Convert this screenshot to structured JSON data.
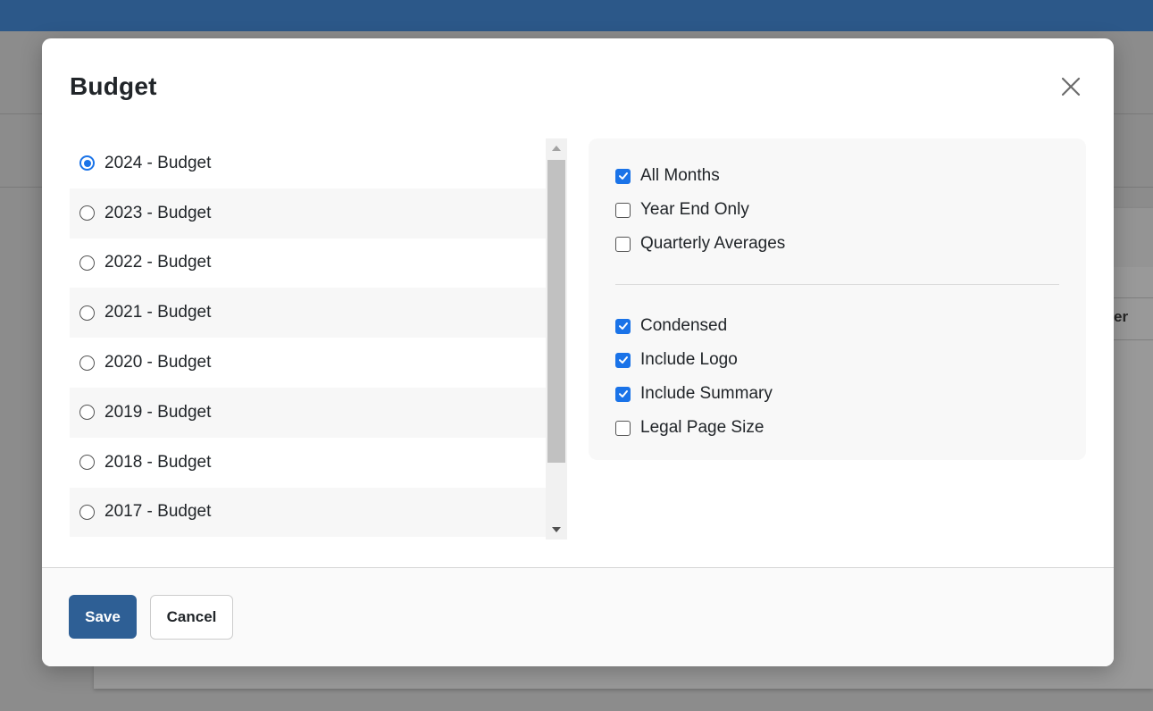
{
  "modal": {
    "title": "Budget"
  },
  "budgets": [
    {
      "label": "2024 - Budget",
      "selected": true
    },
    {
      "label": "2023 - Budget",
      "selected": false
    },
    {
      "label": "2022 - Budget",
      "selected": false
    },
    {
      "label": "2021 - Budget",
      "selected": false
    },
    {
      "label": "2020 - Budget",
      "selected": false
    },
    {
      "label": "2019 - Budget",
      "selected": false
    },
    {
      "label": "2018 - Budget",
      "selected": false
    },
    {
      "label": "2017 - Budget",
      "selected": false
    }
  ],
  "options": {
    "period": [
      {
        "label": "All Months",
        "checked": true
      },
      {
        "label": "Year End Only",
        "checked": false
      },
      {
        "label": "Quarterly Averages",
        "checked": false
      }
    ],
    "format": [
      {
        "label": "Condensed",
        "checked": true
      },
      {
        "label": "Include Logo",
        "checked": true
      },
      {
        "label": "Include Summary",
        "checked": true
      },
      {
        "label": "Legal Page Size",
        "checked": false
      }
    ]
  },
  "footer": {
    "save_label": "Save",
    "cancel_label": "Cancel"
  },
  "background": {
    "column_header_partial": "er"
  },
  "colors": {
    "topbar": "#2c5889",
    "accent": "#1a73e8",
    "primary_button": "#2e5f95"
  },
  "icons": {
    "close": "close-icon",
    "scroll_up": "arrow-up-icon",
    "scroll_down": "arrow-down-icon",
    "check": "checkmark-icon"
  }
}
